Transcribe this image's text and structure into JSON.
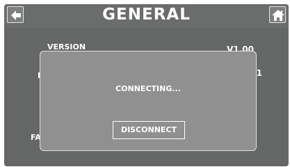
{
  "header": {
    "title": "GENERAL",
    "back_icon": "arrow-left-icon",
    "home_icon": "home-icon"
  },
  "settings": {
    "version_label": "VERSION",
    "version_value": "V1.00",
    "partial_left_char": "I",
    "partial_right_char": "1",
    "partial_bottom_label": "FA"
  },
  "dialog": {
    "message": "CONNECTING...",
    "button_label": "DISCONNECT"
  },
  "colors": {
    "background": "#656666",
    "dialog": "#8f908f",
    "text": "#ffffff"
  }
}
